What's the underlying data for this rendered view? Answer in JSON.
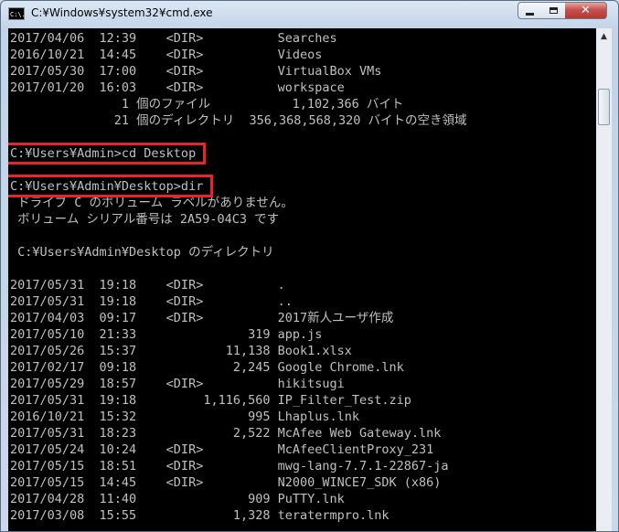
{
  "window": {
    "title": "C:¥Windows¥system32¥cmd.exe",
    "icon_text": "C:\\."
  },
  "caption_buttons": {
    "minimize": "minimize-icon",
    "maximize": "maximize-icon",
    "close": "✕"
  },
  "console_lines": [
    "2017/04/06  12:39    <DIR>          Searches",
    "2016/10/21  14:45    <DIR>          Videos",
    "2017/05/30  17:00    <DIR>          VirtualBox VMs",
    "2017/01/20  16:03    <DIR>          workspace",
    "               1 個のファイル           1,102,366 バイト",
    "              21 個のディレクトリ  356,368,568,320 バイトの空き領域",
    "",
    "C:¥Users¥Admin>cd Desktop",
    "",
    "C:¥Users¥Admin¥Desktop>dir",
    " ドライブ C のボリューム ラベルがありません。",
    " ボリューム シリアル番号は 2A59-04C3 です",
    "",
    " C:¥Users¥Admin¥Desktop のディレクトリ",
    "",
    "2017/05/31  19:18    <DIR>          .",
    "2017/05/31  19:18    <DIR>          ..",
    "2017/04/03  09:17    <DIR>          2017新人ユーザ作成",
    "2017/05/10  21:33               319 app.js",
    "2017/05/26  15:37            11,138 Book1.xlsx",
    "2017/02/17  09:18             2,245 Google Chrome.lnk",
    "2017/05/29  18:57    <DIR>          hikitsugi",
    "2017/05/31  19:18         1,116,560 IP_Filter_Test.zip",
    "2016/10/21  15:32               995 Lhaplus.lnk",
    "2017/05/31  18:23             2,522 McAfee Web Gateway.lnk",
    "2017/05/24  10:24    <DIR>          McAfeeClientProxy_231",
    "2017/05/15  18:51    <DIR>          mwg-lang-7.7.1-22867-ja",
    "2017/05/15  14:45    <DIR>          N2000_WINCE7_SDK (x86)",
    "2017/04/28  11:40               909 PuTTY.lnk",
    "2017/03/08  15:55             1,328 teratermpro.lnk"
  ],
  "highlight_color": "#e8252d"
}
